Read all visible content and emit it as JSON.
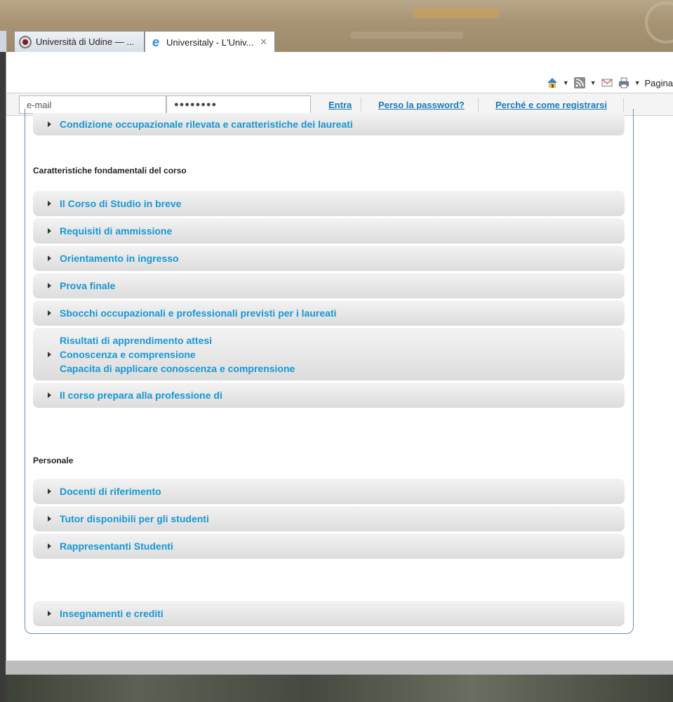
{
  "browser": {
    "tabs": [
      {
        "label": "Università di Udine — ...",
        "icon": "university-seal-icon"
      },
      {
        "label": "Universitaly - L'Univ...",
        "icon": "ie-e-icon",
        "close": "✕"
      }
    ],
    "command_bar": {
      "home": "home-icon",
      "feeds": "rss-icon",
      "mail": "mail-icon",
      "print": "printer-icon",
      "page_label": "Pagina"
    }
  },
  "login": {
    "email_placeholder": "e-mail",
    "password_value": "●●●●●●●●",
    "enter_label": "Entra",
    "lost_password_label": "Perso la password?",
    "why_register_label": "Perché e come registrarsi"
  },
  "main": {
    "top_item": "Condizione occupazionale rilevata e caratteristiche dei laureati",
    "section_course": "Caratteristiche fondamentali del corso",
    "course_items": [
      "Il Corso di Studio in breve",
      "Requisiti di ammissione",
      "Orientamento in ingresso",
      "Prova finale",
      "Sbocchi occupazionali e professionali previsti per i laureati"
    ],
    "learning_item": {
      "line1": "Risultati di apprendimento attesi",
      "line2": "Conoscenza e comprensione",
      "line3": "Capacita di applicare conoscenza e comprensione"
    },
    "profession_item": "Il corso prepara alla professione di",
    "section_staff": "Personale",
    "staff_items": [
      "Docenti di riferimento",
      "Tutor disponibili per gli studenti",
      "Rappresentanti Studenti"
    ],
    "credits_item": "Insegnamenti e crediti"
  },
  "colors": {
    "link": "#1597d6",
    "panel_border": "#6a8db2"
  }
}
